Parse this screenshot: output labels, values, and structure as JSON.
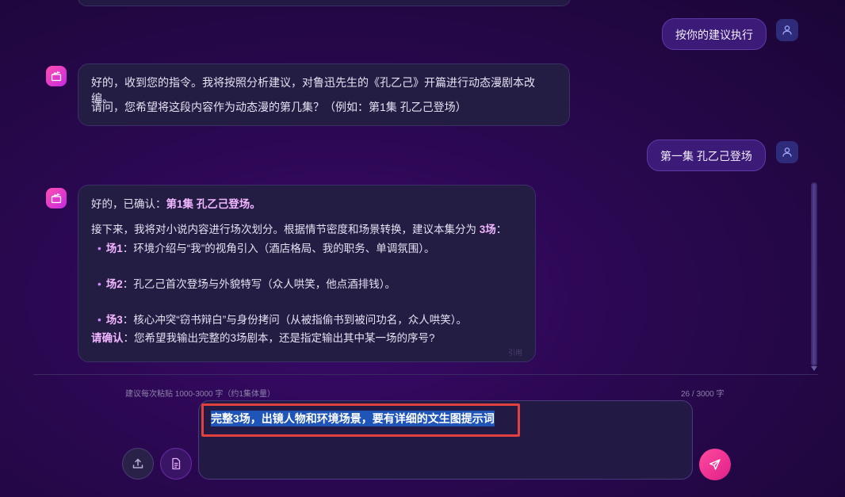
{
  "messages": {
    "user1": {
      "text": "按你的建议执行"
    },
    "bot1": {
      "line1": "好的，收到您的指令。我将按照分析建议，对鲁迅先生的《孔乙己》开篇进行动态漫剧本改编。",
      "line2": "请问，您希望将这段内容作为动态漫的第几集？（例如：第1集 孔乙己登场）"
    },
    "user2": {
      "text": "第一集 孔乙己登场"
    },
    "bot2": {
      "confirm_prefix": "好的，已确认：",
      "confirm_bold": "第1集 孔乙己登场。",
      "intro": "接下来，我将对小说内容进行场次划分。根据情节密度和场景转换，建议本集分为 ",
      "intro_bold": "3场",
      "intro_suffix": "：",
      "scenes": [
        {
          "label": "场1",
          "text": "：环境介绍与“我”的视角引入（酒店格局、我的职务、单调氛围）。"
        },
        {
          "label": "场2",
          "text": "：孔乙己首次登场与外貌特写（众人哄笑，他点酒排钱）。"
        },
        {
          "label": "场3",
          "text": "：核心冲突“窃书辩白”与身份拷问（从被指偷书到被问功名，众人哄笑）。"
        }
      ],
      "ask_bold": "请确认",
      "ask_text": "：您希望我输出完整的3场剧本，还是指定输出其中某一场的序号?",
      "faded_action": "引用"
    }
  },
  "composer": {
    "hint": "建议每次粘贴 1000-3000 字（约1集体量）",
    "counter": "26 / 3000 字",
    "input_value": "完整3场，出镜人物和环境场景，要有详细的文生图提示词"
  },
  "colors": {
    "accent": "#ff3d9a",
    "highlight": "#e0413f",
    "selection": "#1f54b8"
  },
  "icons": {
    "user_avatar": "user-icon",
    "bot_avatar": "clapperboard-icon",
    "upload": "upload-icon",
    "document": "document-icon",
    "send": "send-icon"
  }
}
